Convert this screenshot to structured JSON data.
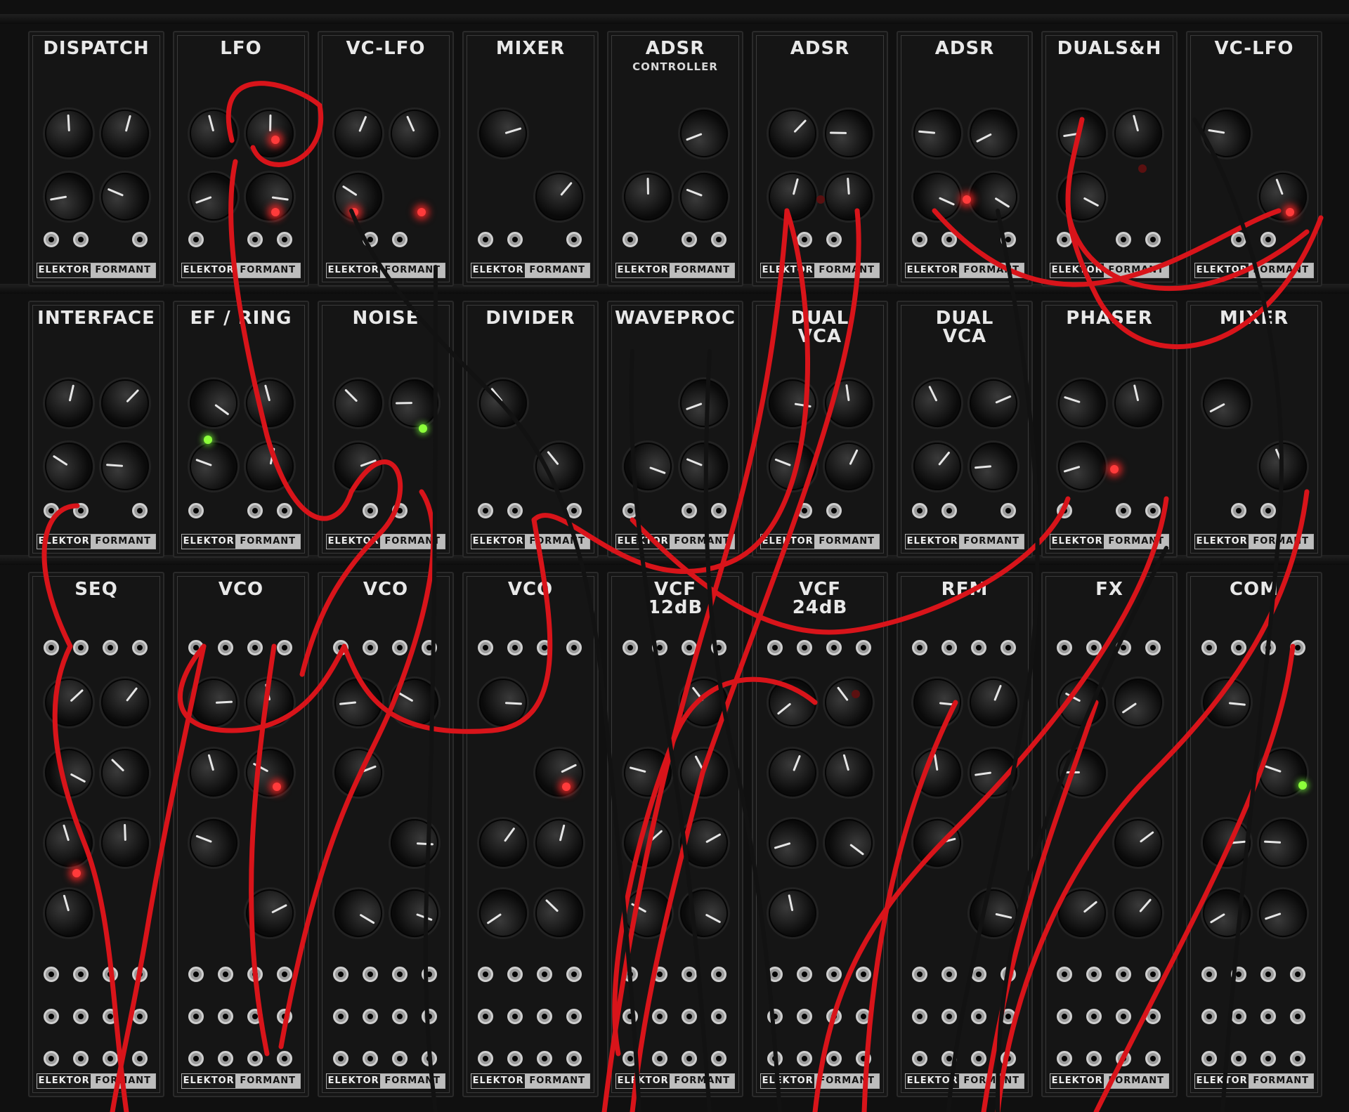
{
  "brand": {
    "left": "ELEKTOR",
    "right": "FORMANT"
  },
  "colors": {
    "cable_red": "#d8141a",
    "cable_black": "#121212",
    "led_red": "#ff3b3b",
    "led_green": "#8cff3a",
    "panel": "#151515"
  },
  "rows": [
    {
      "modules": [
        {
          "title": "DISPATCH",
          "sub": ""
        },
        {
          "title": "LFO",
          "sub": ""
        },
        {
          "title": "VC-LFO",
          "sub": ""
        },
        {
          "title": "MIXER",
          "sub": ""
        },
        {
          "title": "ADSR",
          "sub": "CONTROLLER"
        },
        {
          "title": "ADSR",
          "sub": ""
        },
        {
          "title": "ADSR",
          "sub": ""
        },
        {
          "title": "DUALS&H",
          "sub": ""
        },
        {
          "title": "VC-LFO",
          "sub": ""
        }
      ]
    },
    {
      "modules": [
        {
          "title": "INTERFACE",
          "sub": ""
        },
        {
          "title": "EF / RING",
          "sub": ""
        },
        {
          "title": "NOISE",
          "sub": ""
        },
        {
          "title": "DIVIDER",
          "sub": ""
        },
        {
          "title": "WAVEPROC",
          "sub": ""
        },
        {
          "title": "DUAL\nVCA",
          "sub": ""
        },
        {
          "title": "DUAL\nVCA",
          "sub": ""
        },
        {
          "title": "PHASER",
          "sub": ""
        },
        {
          "title": "MIXER",
          "sub": ""
        }
      ]
    },
    {
      "modules": [
        {
          "title": "SEQ",
          "sub": ""
        },
        {
          "title": "VCO",
          "sub": ""
        },
        {
          "title": "VCO",
          "sub": ""
        },
        {
          "title": "VCO",
          "sub": ""
        },
        {
          "title": "VCF\n12dB",
          "sub": ""
        },
        {
          "title": "VCF\n24dB",
          "sub": ""
        },
        {
          "title": "RFM",
          "sub": ""
        },
        {
          "title": "FX",
          "sub": ""
        },
        {
          "title": "COM",
          "sub": ""
        }
      ]
    }
  ]
}
